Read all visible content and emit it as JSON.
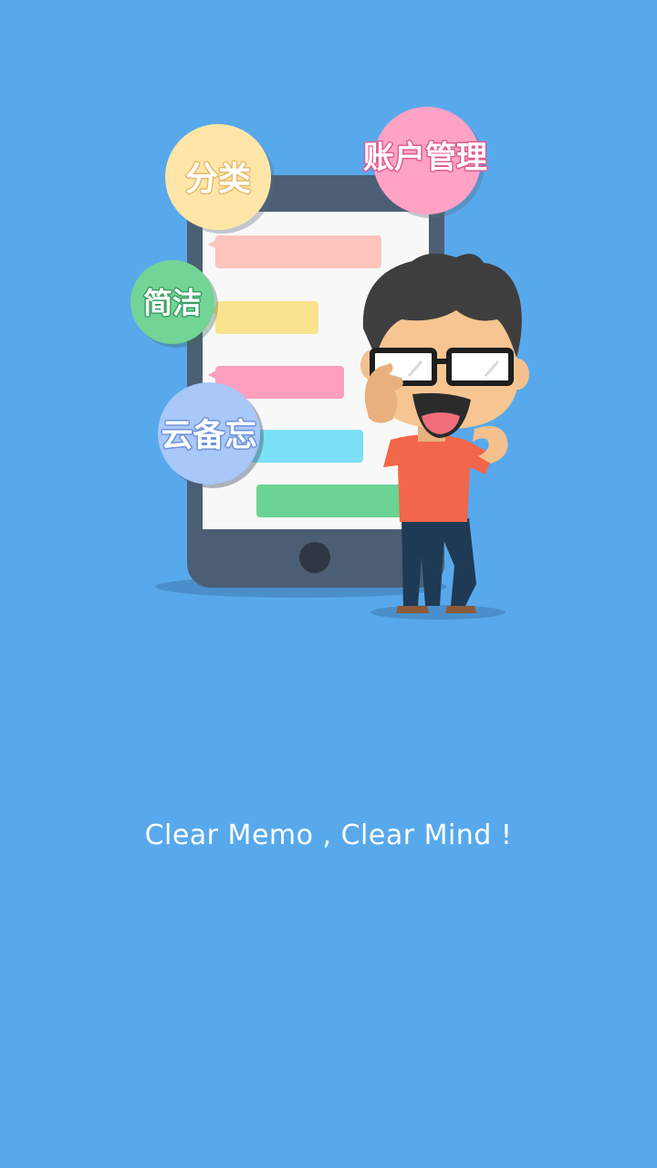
{
  "app": {
    "background": "#58A9EB",
    "tagline": "Clear Memo , Clear Mind !"
  },
  "bubbles": {
    "category": {
      "label": "分类",
      "color": "#FFE6A8"
    },
    "account": {
      "label": "账户管理",
      "color": "#FFA2C5"
    },
    "simple": {
      "label": "简洁",
      "color": "#72D495"
    },
    "cloud": {
      "label": "云备忘",
      "color": "#A7C8F8"
    }
  },
  "memo_bar_colors": [
    "#FEC4BD",
    "#F9E38C",
    "#FF9FC0",
    "#7BE0F6",
    "#6BD394"
  ],
  "icons": {
    "phone": "phone-illustration",
    "character": "cartoon-man-with-glasses"
  }
}
